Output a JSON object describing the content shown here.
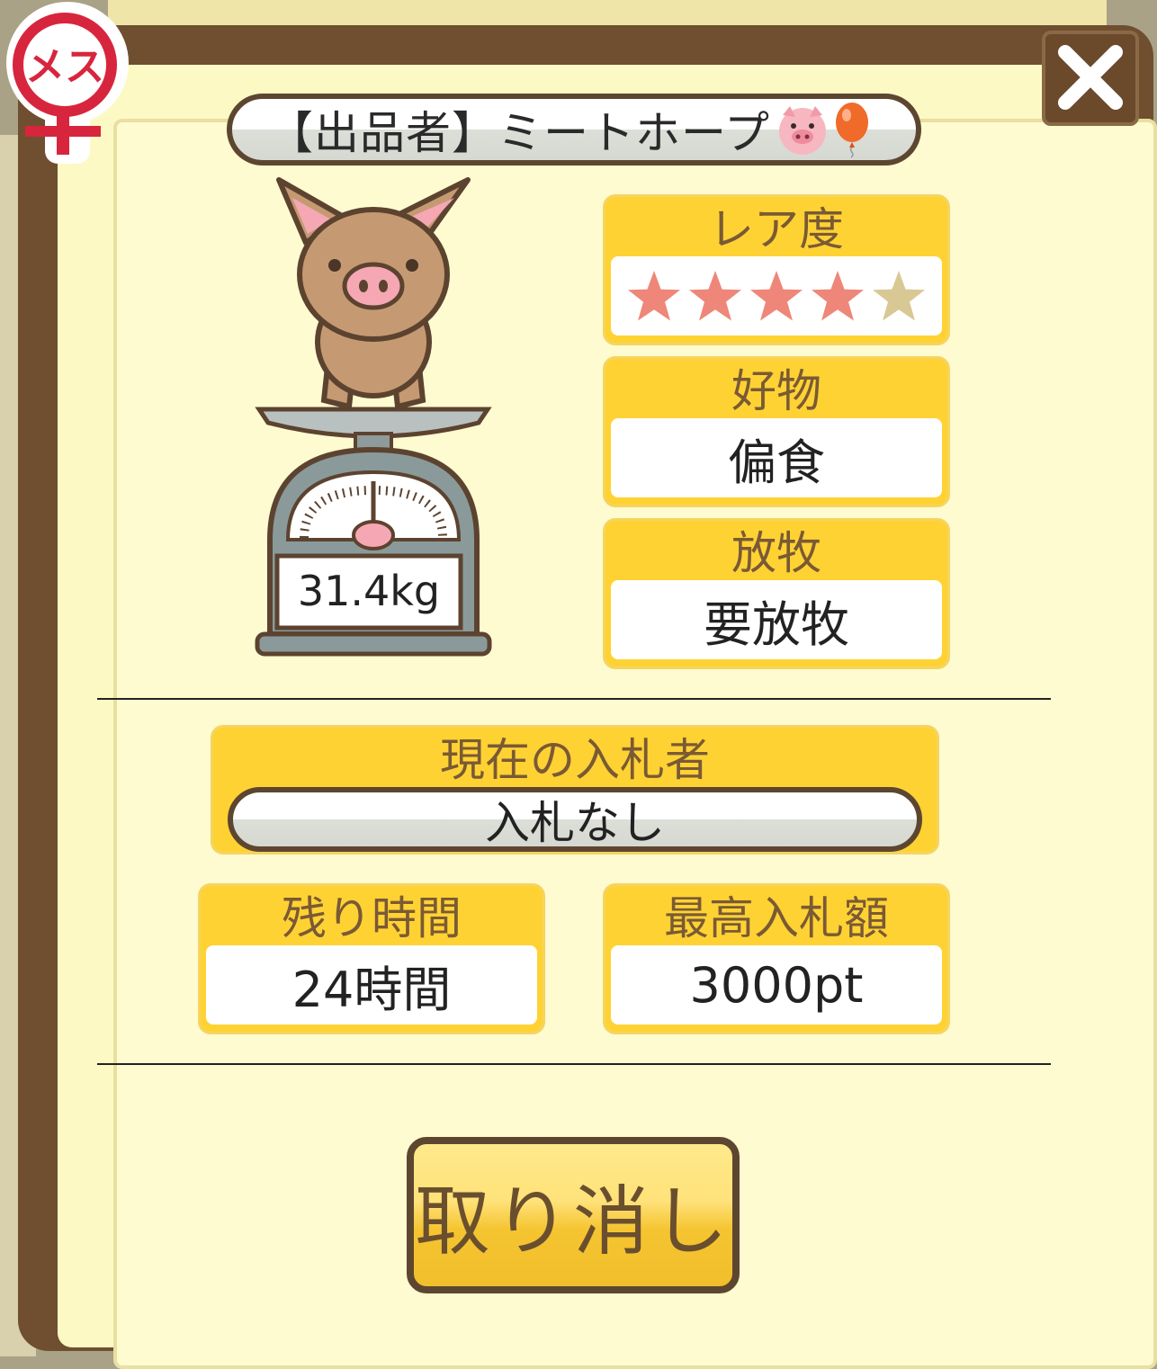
{
  "seller": {
    "label": "【出品者】ミートホープ",
    "icons": [
      "pig-face-icon",
      "balloon-icon"
    ]
  },
  "gender_badge": {
    "label": "メス",
    "icon": "female-symbol-icon"
  },
  "close": {
    "icon": "close-icon"
  },
  "pig": {
    "weight": "31.4kg"
  },
  "rarity": {
    "label": "レア度",
    "stars_total": 5,
    "stars_filled": 4,
    "filled_color": "#ee8779",
    "empty_color": "#d8c894"
  },
  "favorite_food": {
    "label": "好物",
    "value": "偏食"
  },
  "grazing": {
    "label": "放牧",
    "value": "要放牧"
  },
  "bidder": {
    "label": "現在の入札者",
    "value": "入札なし"
  },
  "time_left": {
    "label": "残り時間",
    "value": "24時間"
  },
  "highest_bid": {
    "label": "最高入札額",
    "value": "3000pt"
  },
  "cancel_button": {
    "label": "取り消し"
  },
  "colors": {
    "frame": "#6f4f30",
    "panel": "#fffbd0",
    "header": "#ffd234",
    "button": "#f5c431"
  }
}
